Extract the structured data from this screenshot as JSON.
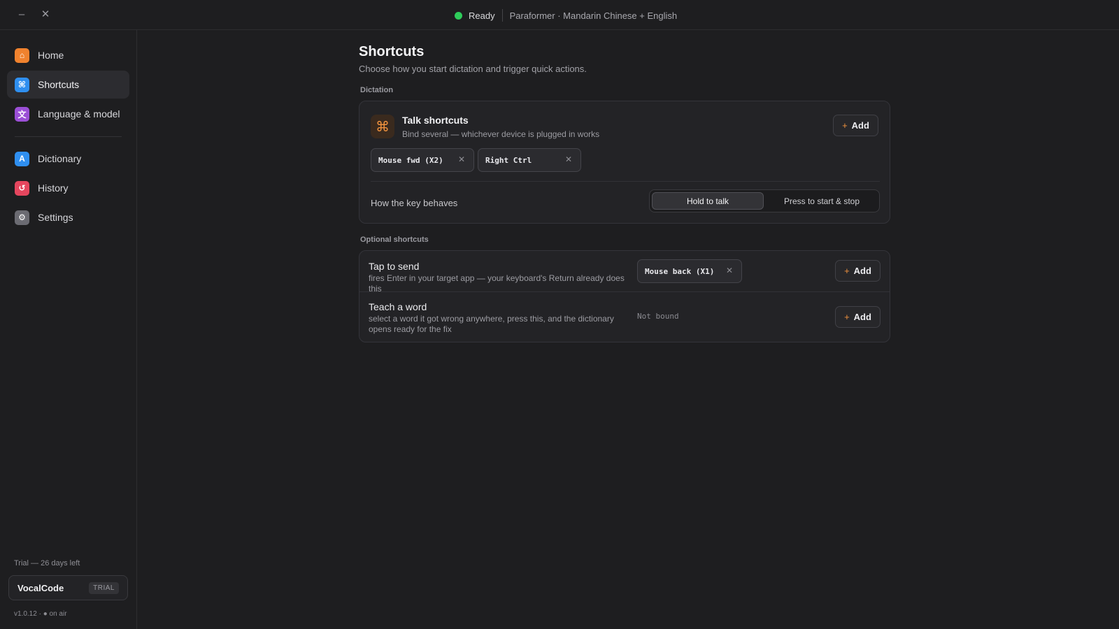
{
  "window": {
    "minimize_glyph": "–",
    "close_glyph": "✕",
    "status": "Ready",
    "model": "Paraformer · Mandarin Chinese + English"
  },
  "sidebar": {
    "items": [
      {
        "label": "Home",
        "icon": "home-icon",
        "glyph": "⌂",
        "color": "#f0822e"
      },
      {
        "label": "Shortcuts",
        "icon": "command-icon",
        "glyph": "⌘",
        "color": "#2f8ff0"
      },
      {
        "label": "Language & model",
        "icon": "translate-icon",
        "glyph": "文",
        "color": "#9b4fd6"
      },
      {
        "label": "Dictionary",
        "icon": "dictionary-icon",
        "glyph": "A",
        "color": "#2f8ff0"
      },
      {
        "label": "History",
        "icon": "history-icon",
        "glyph": "↺",
        "color": "#e5465e"
      },
      {
        "label": "Settings",
        "icon": "gear-icon",
        "glyph": "⚙",
        "color": "#6b6b72"
      }
    ],
    "active": "Shortcuts",
    "trial_text": "Trial — 26 days left",
    "license_name": "VocalCode",
    "license_badge": "TRIAL",
    "version": "v1.0.12 · ● on air"
  },
  "main": {
    "title": "Shortcuts",
    "subtitle": "Choose how you start dictation and trigger quick actions.",
    "dictation_section": "Dictation",
    "talk": {
      "icon_glyph": "⌘",
      "title": "Talk shortcuts",
      "description": "Bind several — whichever device is plugged in works",
      "add_label": "Add",
      "chips": [
        "Mouse fwd (X2)",
        "Right Ctrl"
      ],
      "behave_label": "How the key behaves",
      "modes": [
        "Hold to talk",
        "Press to start & stop"
      ],
      "selected_mode": "Hold to talk"
    },
    "optional_section": "Optional shortcuts",
    "optional": [
      {
        "title": "Tap to send",
        "description": "fires Enter in your target app — your keyboard's Return already does this",
        "binding": "Mouse back (X1)",
        "add_label": "Add"
      },
      {
        "title": "Teach a word",
        "description": "select a word it got wrong anywhere, press this, and the dictionary opens ready for the fix",
        "binding": "Not bound",
        "add_label": "Add"
      }
    ],
    "plus_glyph": "+",
    "remove_glyph": "✕",
    "accent_color": "#f0923e"
  }
}
